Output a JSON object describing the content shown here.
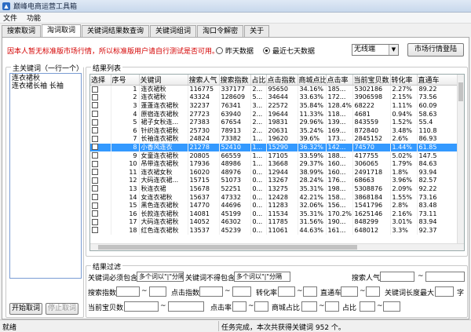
{
  "window": {
    "title": "巅峰电商运营工具箱"
  },
  "menu": [
    "文件",
    "功能"
  ],
  "tabs": [
    "搜索取词",
    "淘词取词",
    "关键词结果数查询",
    "关键词组词",
    "淘口令解密",
    "关于"
  ],
  "active_tab": 1,
  "notice": "因本人暂无标准版市场行情，所以标准版用户请自行测试是否可用。",
  "radios": [
    {
      "label": "昨天数据",
      "checked": false
    },
    {
      "label": "最近七天数据",
      "checked": true
    }
  ],
  "device_select": {
    "value": "无线端"
  },
  "market_button": "市场行情登陆",
  "keyword_panel": {
    "title": "主关键词（一行一个）",
    "lines": [
      "连衣裙秋",
      "连衣裙长袖 长袖"
    ],
    "start_button": "开始取词",
    "stop_button": "停止取词"
  },
  "results": {
    "title": "结果列表",
    "columns": [
      "选择",
      "序号",
      "关键词",
      "搜索人气",
      "搜索指数",
      "占比",
      "点击指数",
      "商城点比",
      "点击率",
      "当前宝贝数",
      "转化率",
      "直通车"
    ],
    "selected_index": 7,
    "rows": [
      [
        "1",
        "连衣裙秋",
        "116775",
        "337177",
        "2...",
        "95650",
        "34.16%",
        "185...",
        "5302186",
        "2.27%",
        "89.22"
      ],
      [
        "2",
        "连衣裙秋",
        "43324",
        "128609",
        "5...",
        "34644",
        "33.63%",
        "172...",
        "3906598",
        "2.15%",
        "73.56"
      ],
      [
        "3",
        "蓬蓬连衣裙秋",
        "32237",
        "76341",
        "3...",
        "22572",
        "35.84%",
        "128.4%",
        "68222",
        "1.11%",
        "60.09"
      ],
      [
        "4",
        "原宿连衣裙秋",
        "27723",
        "63940",
        "2...",
        "19644",
        "11.33%",
        "118...",
        "4681",
        "0.94%",
        "58.63"
      ],
      [
        "5",
        "裙子女秋连...",
        "27383",
        "67654",
        "2...",
        "19831",
        "29.96%",
        "139...",
        "843559",
        "1.52%",
        "55.4"
      ],
      [
        "6",
        "针织连衣裙秋",
        "25730",
        "78913",
        "2...",
        "20631",
        "35.24%",
        "169...",
        "872840",
        "3.48%",
        "110.8"
      ],
      [
        "7",
        "长袖连衣裙秋",
        "24824",
        "73382",
        "1...",
        "19620",
        "39.6%",
        "173...",
        "2845152",
        "2.6%",
        "86.93"
      ],
      [
        "8",
        "小香风连衣",
        "21278",
        "52410",
        "1...",
        "15290",
        "36.32%",
        "142...",
        "74570",
        "1.44%",
        "61.85"
      ],
      [
        "9",
        "女童连衣裙秋",
        "20805",
        "66559",
        "1...",
        "17105",
        "33.59%",
        "188...",
        "417755",
        "5.02%",
        "147.5"
      ],
      [
        "10",
        "吊带连衣裙秋",
        "17936",
        "48986",
        "1...",
        "13668",
        "29.37%",
        "160...",
        "306065",
        "1.79%",
        "84.63"
      ],
      [
        "11",
        "连衣裙女秋",
        "16020",
        "48976",
        "0...",
        "12944",
        "38.99%",
        "160...",
        "2491718",
        "1.8%",
        "93.94"
      ],
      [
        "12",
        "大码连衣裙...",
        "15715",
        "51073",
        "0...",
        "13267",
        "28.24%",
        "176...",
        "68663",
        "3.96%",
        "82.57"
      ],
      [
        "13",
        "秋连衣裙",
        "15678",
        "52251",
        "0...",
        "13275",
        "35.31%",
        "198...",
        "5308876",
        "2.09%",
        "92.22"
      ],
      [
        "14",
        "女连衣裙秋",
        "15637",
        "47332",
        "0...",
        "12428",
        "42.21%",
        "158...",
        "3868184",
        "1.55%",
        "73.16"
      ],
      [
        "15",
        "黑色连衣裙秋",
        "14770",
        "44696",
        "0...",
        "11283",
        "32.06%",
        "156...",
        "1541796",
        "2.8%",
        "83.48"
      ],
      [
        "16",
        "长款连衣裙秋",
        "14081",
        "45199",
        "0...",
        "11534",
        "35.31%",
        "170.2%",
        "1625146",
        "2.16%",
        "73.11"
      ],
      [
        "17",
        "大码连衣裙秋",
        "14052",
        "46302",
        "0...",
        "11785",
        "31.56%",
        "190...",
        "848299",
        "3.01%",
        "83.94"
      ],
      [
        "18",
        "红色连衣裙秋",
        "13537",
        "45239",
        "0...",
        "11061",
        "44.63%",
        "161...",
        "648012",
        "3.3%",
        "92.37"
      ]
    ]
  },
  "filter": {
    "title": "结果过滤",
    "must_contain_label": "关键词必须包含",
    "must_contain_placeholder": "多个词以\"|\"分隔",
    "must_not_contain_label": "关键词不得包含",
    "must_not_contain_placeholder": "多个词以\"|\"分隔",
    "search_popularity": "搜索人气",
    "search_index": "搜索指数",
    "click_index": "点击指数",
    "conversion": "转化率",
    "ztc": "直通车",
    "max_length": "关键词长度最大",
    "char_unit": "字",
    "items": "当前宝贝数",
    "ctr": "点击率",
    "mall_ratio": "商城占比",
    "share": "占比",
    "tilde": "~"
  },
  "status": {
    "left": "就绪",
    "message": "任务完成，本次共获得关键词 952 个。"
  }
}
